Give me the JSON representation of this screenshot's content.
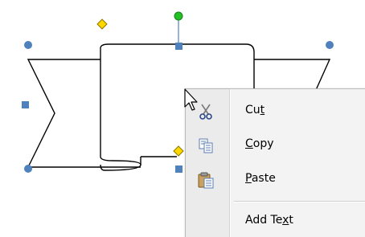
{
  "context_menu": {
    "items": [
      {
        "id": "cut",
        "before": "Cu",
        "accel": "t",
        "after": "",
        "icon": "scissors-icon"
      },
      {
        "id": "copy",
        "before": "",
        "accel": "C",
        "after": "opy",
        "icon": "copy-icon"
      },
      {
        "id": "paste",
        "before": "",
        "accel": "P",
        "after": "aste",
        "icon": "paste-icon"
      },
      {
        "id": "add_text",
        "before": "Add Te",
        "accel": "x",
        "after": "t",
        "icon": null
      }
    ]
  },
  "shape": {
    "name": "ribbon-banner",
    "outline_color": "#000000",
    "handle_color": "#4f81bd",
    "adjust_handle_color": "#ffd700",
    "rotate_handle_color": "#22c022"
  }
}
